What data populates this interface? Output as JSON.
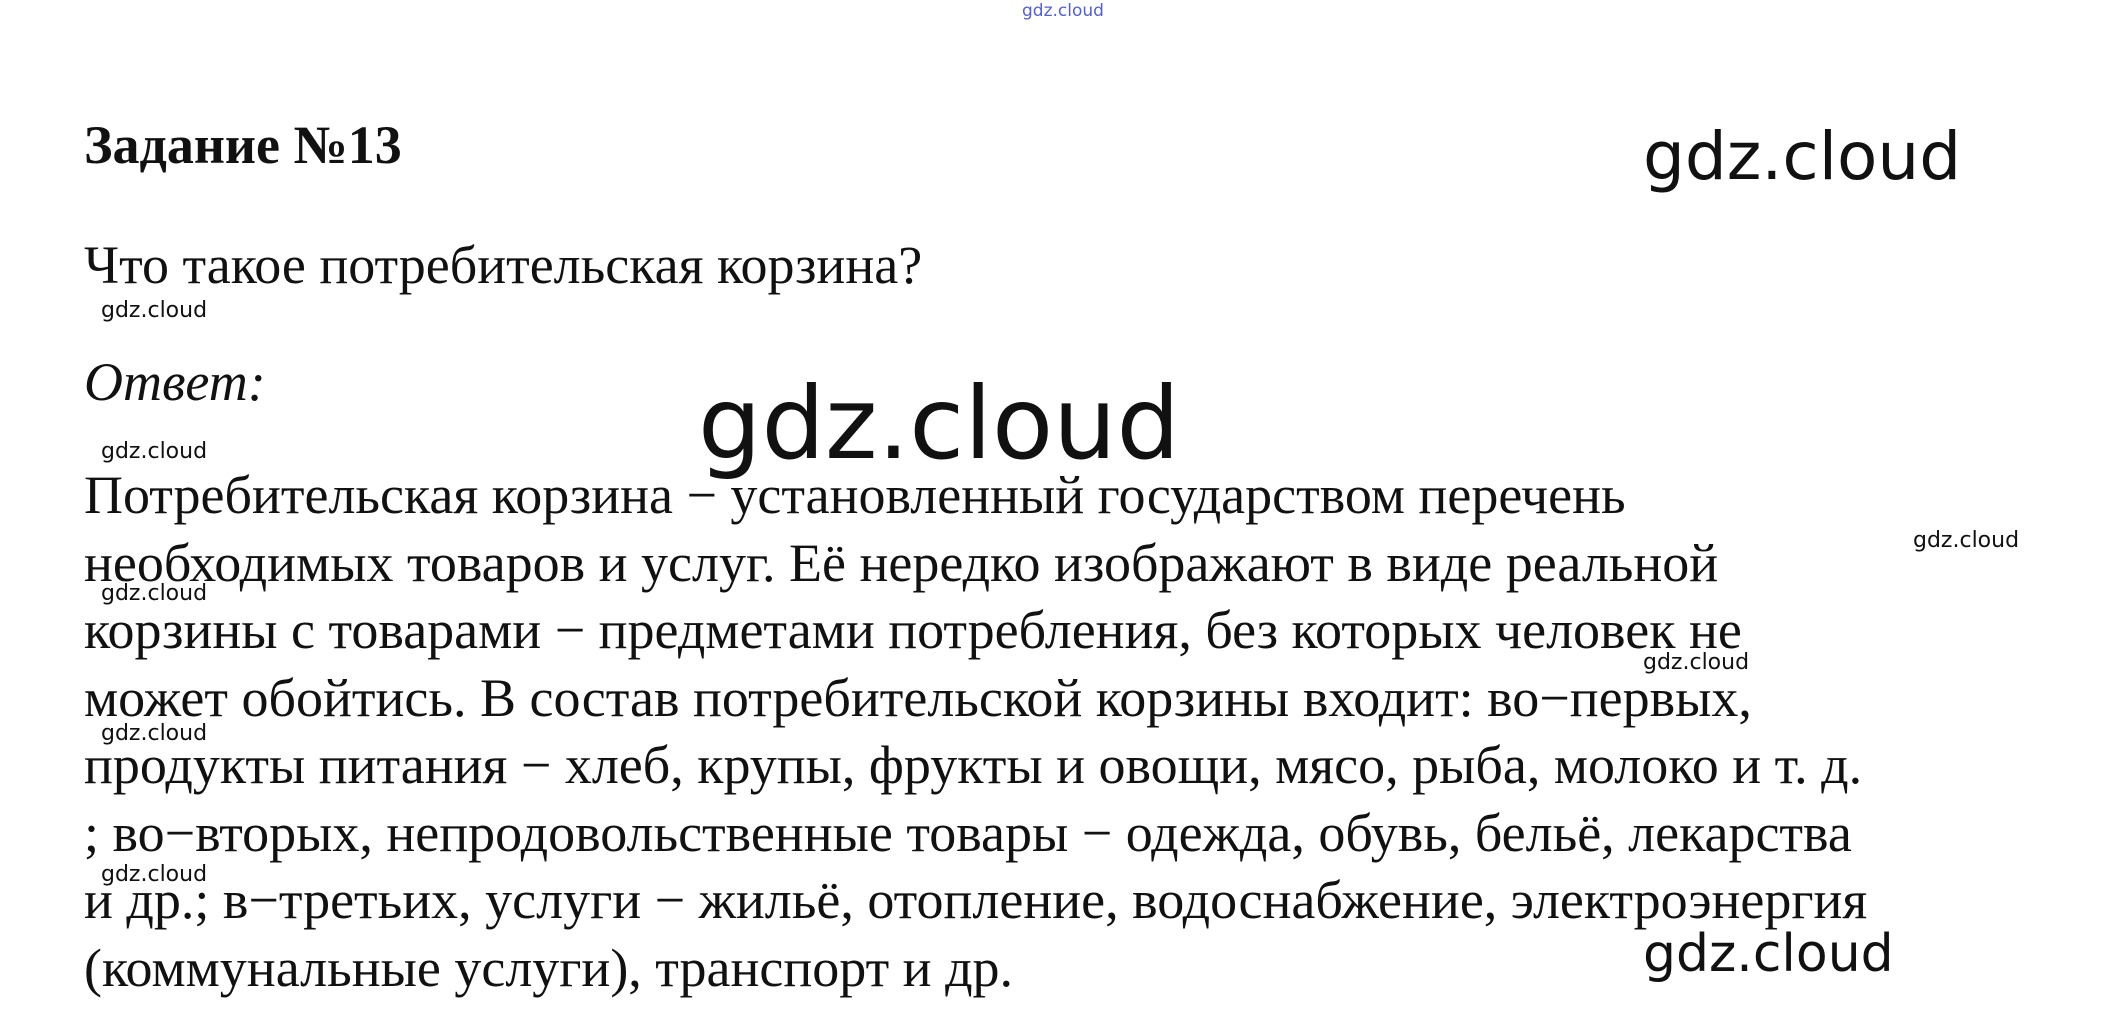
{
  "heading": "Задание №13",
  "question": "Что такое потребительская корзина?",
  "answer_label": "Ответ:",
  "answer_lines": [
    "Потребительская корзина − установленный государством перечень",
    "необходимых товаров и услуг. Её нередко изображают в виде реальной",
    "корзины с товарами − предметами потребления, без которых человек не",
    "может обойтись. В состав потребительской корзины входит: во−первых,",
    "продукты питания − хлеб, крупы, фрукты и овощи, мясо, рыба, молоко и т. д.",
    "; во−вторых, непродовольственные товары − одежда, обувь, бельё, лекарства",
    "и др.; в−третьих, услуги − жильё, отопление, водоснабжение, электроэнергия",
    "(коммунальные услуги), транспорт и др."
  ],
  "watermarks": {
    "top": "gdz.cloud",
    "large_a": "gdz.cloud",
    "huge": "gdz.cloud",
    "large_b": "gdz.cloud",
    "small": [
      "gdz.cloud",
      "gdz.cloud",
      "gdz.cloud",
      "gdz.cloud",
      "gdz.cloud",
      "gdz.cloud",
      "gdz.cloud"
    ]
  },
  "colors": {
    "text": "#111111",
    "top_watermark": "#5560c8",
    "background": "#ffffff"
  }
}
